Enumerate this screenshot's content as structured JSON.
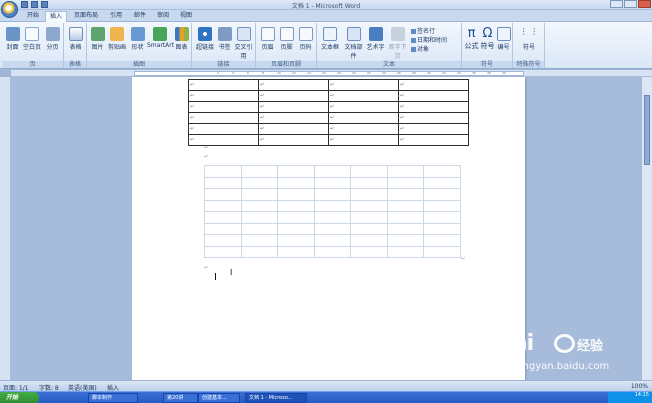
{
  "window": {
    "title": "文档 1 - Microsoft Word"
  },
  "tabs": [
    {
      "label": "开始"
    },
    {
      "label": "插入"
    },
    {
      "label": "页面布局"
    },
    {
      "label": "引用"
    },
    {
      "label": "邮件"
    },
    {
      "label": "审阅"
    },
    {
      "label": "视图"
    }
  ],
  "ribbon": {
    "groups": [
      {
        "caption": "页"
      },
      {
        "caption": "表格"
      },
      {
        "caption": "插图"
      },
      {
        "caption": "链接"
      },
      {
        "caption": "页眉和页脚"
      },
      {
        "caption": "文本"
      },
      {
        "caption": "符号"
      },
      {
        "caption": "特殊符号"
      }
    ],
    "commands": [
      {
        "label": "封面"
      },
      {
        "label": "空白页"
      },
      {
        "label": "分页"
      },
      {
        "label": "表格"
      },
      {
        "label": "图片"
      },
      {
        "label": "剪贴画"
      },
      {
        "label": "形状"
      },
      {
        "label": "SmartArt"
      },
      {
        "label": "图表"
      },
      {
        "label": "超链接"
      },
      {
        "label": "书签"
      },
      {
        "label": "交叉引用"
      },
      {
        "label": "页眉"
      },
      {
        "label": "页脚"
      },
      {
        "label": "页码"
      },
      {
        "label": "文本框"
      },
      {
        "label": "文档部件"
      },
      {
        "label": "艺术字"
      },
      {
        "label": "首字下沉"
      },
      {
        "label": "公式"
      },
      {
        "label": "符号"
      },
      {
        "label": "编号"
      },
      {
        "label": "符号"
      }
    ],
    "small_commands": [
      {
        "label": "签名行"
      },
      {
        "label": "日期和时间"
      },
      {
        "label": "对象"
      }
    ]
  },
  "ruler_ticks": [
    "2",
    "4",
    "6",
    "8",
    "10",
    "12",
    "14",
    "16",
    "18",
    "20",
    "22",
    "24",
    "26",
    "28",
    "30",
    "32",
    "34",
    "36",
    "38",
    "40"
  ],
  "document": {
    "paragraph_mark": "↵",
    "bordered_table": {
      "rows": 6,
      "columns": 4
    },
    "gridline_table": {
      "rows": 8,
      "columns": 7
    }
  },
  "status": {
    "page": "页面: 1/1",
    "words": "字数: 8",
    "language": "英语(美国)",
    "mode": "插入",
    "zoom": "100%"
  },
  "taskbar": {
    "start": "开始",
    "items": [
      {
        "label": "脚本制作"
      },
      {
        "label": "第20讲"
      },
      {
        "label": "创建基本..."
      },
      {
        "label": "文档 1 - Microso..."
      }
    ],
    "clock": "14:15"
  },
  "watermark": {
    "logo": "Bai",
    "text": "经验",
    "url": "jingyan.baidu.com"
  },
  "colors": {
    "ribbon": "#dbe7f7",
    "taskbar": "#245ac5",
    "page_background": "#a7bcda"
  }
}
